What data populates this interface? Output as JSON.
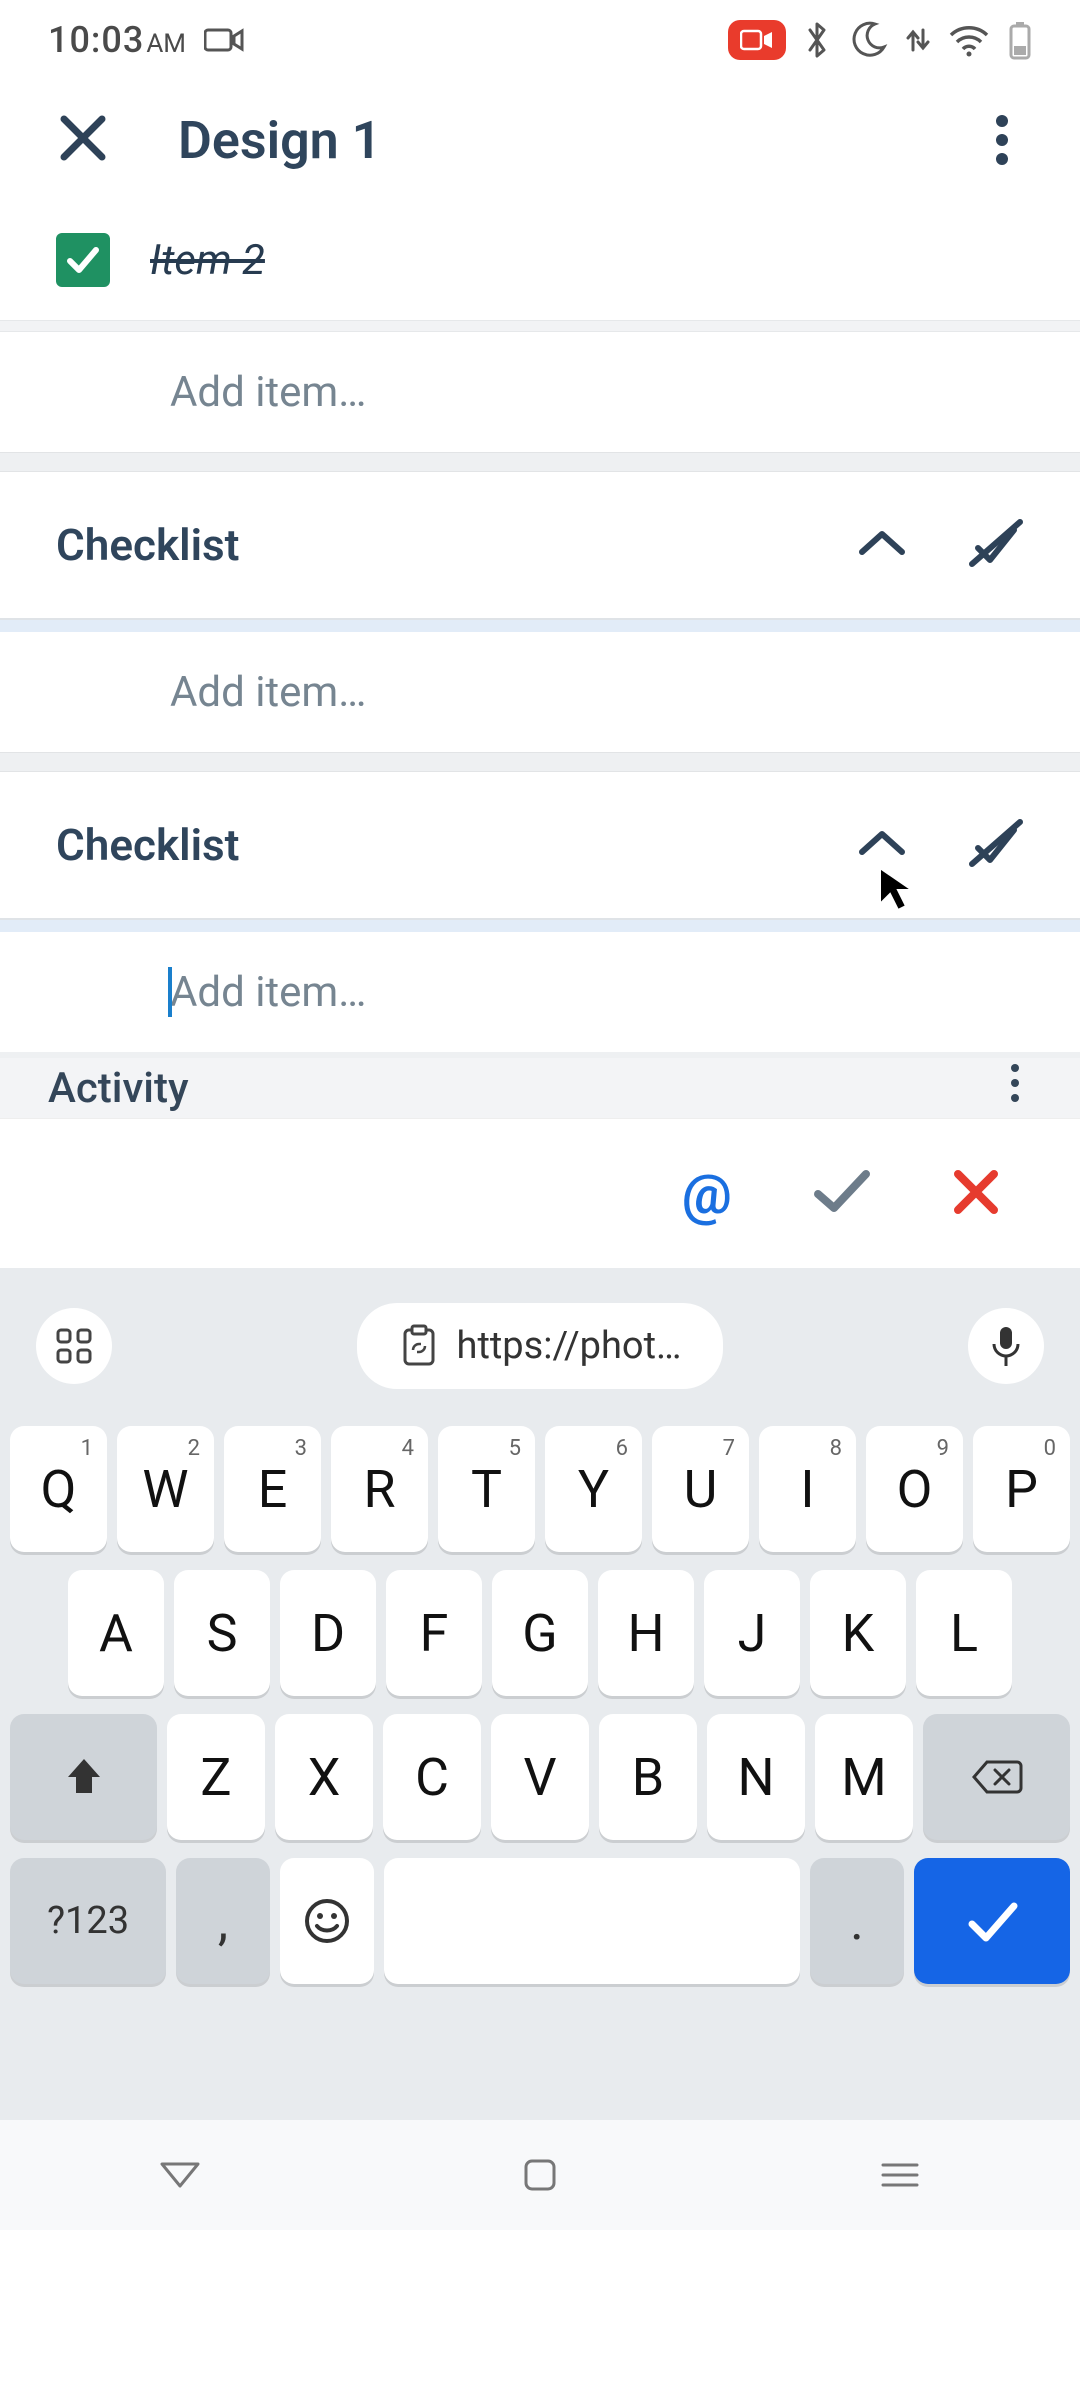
{
  "status": {
    "time": "10:03",
    "ampm": "AM"
  },
  "header": {
    "title": "Design 1"
  },
  "checked_item": {
    "label": "Item 2"
  },
  "add_item_placeholder": "Add item…",
  "checklists": [
    {
      "title": "Checklist"
    },
    {
      "title": "Checklist"
    }
  ],
  "activity_label": "Activity",
  "keyboard": {
    "clipboard_text": "https://phot…",
    "row1": [
      {
        "k": "Q",
        "n": "1"
      },
      {
        "k": "W",
        "n": "2"
      },
      {
        "k": "E",
        "n": "3"
      },
      {
        "k": "R",
        "n": "4"
      },
      {
        "k": "T",
        "n": "5"
      },
      {
        "k": "Y",
        "n": "6"
      },
      {
        "k": "U",
        "n": "7"
      },
      {
        "k": "I",
        "n": "8"
      },
      {
        "k": "O",
        "n": "9"
      },
      {
        "k": "P",
        "n": "0"
      }
    ],
    "row2": [
      "A",
      "S",
      "D",
      "F",
      "G",
      "H",
      "J",
      "K",
      "L"
    ],
    "row3": [
      "Z",
      "X",
      "C",
      "V",
      "B",
      "N",
      "M"
    ],
    "symkey": "?123",
    "comma": ",",
    "period": "."
  }
}
